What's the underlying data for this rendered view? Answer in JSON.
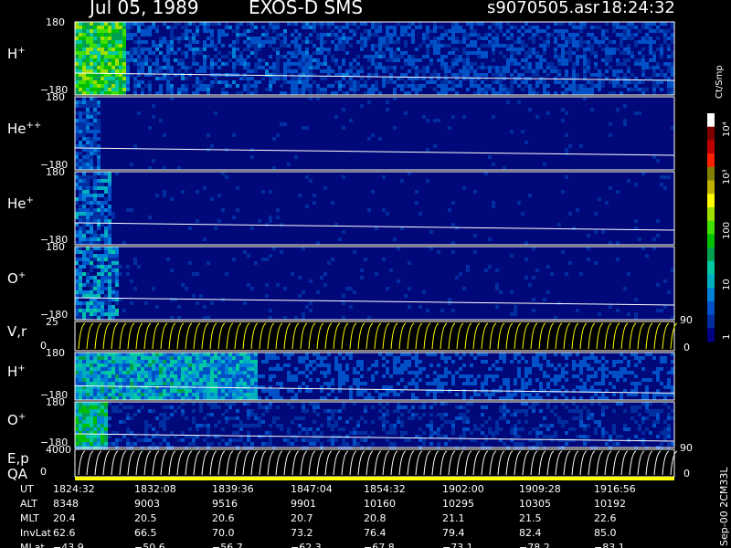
{
  "header": {
    "date": "Jul 05, 1989",
    "instrument": "EXOS-D SMS",
    "file": "s9070505.asr",
    "time": "18:24:32"
  },
  "colorbar": {
    "unit": "Ct/Smp",
    "ticks": [
      "1",
      "10",
      "100",
      "10³",
      "10⁴"
    ],
    "colors": [
      "#000080",
      "#002ea0",
      "#0050c8",
      "#0080d8",
      "#00b0c0",
      "#00c8a0",
      "#00a050",
      "#00c000",
      "#40e000",
      "#a0e000",
      "#ffff00",
      "#c0b000",
      "#808000",
      "#ff2000",
      "#c00000",
      "#800000",
      "#ffffff"
    ]
  },
  "chart_data": {
    "type": "heatmap",
    "panels": [
      {
        "name": "H",
        "sup": "+",
        "yticks": [
          "180",
          "−180"
        ],
        "ylim": [
          -180,
          180
        ]
      },
      {
        "name": "He",
        "sup": "++",
        "yticks": [
          "180",
          "−180"
        ],
        "ylim": [
          -180,
          180
        ]
      },
      {
        "name": "He",
        "sup": "+",
        "yticks": [
          "180",
          "−180"
        ],
        "ylim": [
          -180,
          180
        ]
      },
      {
        "name": "O",
        "sup": "+",
        "yticks": [
          "180",
          "−180"
        ],
        "ylim": [
          -180,
          180
        ]
      },
      {
        "name": "V,r",
        "sup": "",
        "yticks": [
          "25",
          "0"
        ],
        "right_ticks": [
          "90",
          "0"
        ],
        "ylim": [
          0,
          25
        ]
      },
      {
        "name": "H",
        "sup": "+",
        "yticks": [
          "180",
          "−180"
        ],
        "ylim": [
          -180,
          180
        ]
      },
      {
        "name": "O",
        "sup": "+",
        "yticks": [
          "180",
          "−180"
        ],
        "ylim": [
          -180,
          180
        ]
      },
      {
        "name": "E,p",
        "sup": "",
        "yticks": [
          "4000",
          "0"
        ],
        "right_ticks": [
          "90",
          "0"
        ],
        "ylim": [
          0,
          4000
        ]
      },
      {
        "name": "QA",
        "sup": "",
        "yticks": [],
        "ylim": null
      }
    ],
    "x_times": [
      "1824:32",
      "1832:08",
      "1839:36",
      "1847:04",
      "1854:32",
      "1902:00",
      "1909:28",
      "1916:56"
    ],
    "colorbar_ticks": [
      1,
      10,
      100,
      1000,
      10000
    ],
    "colorbar_unit": "Ct/Smp"
  },
  "ephemeris": {
    "rows": [
      {
        "label": "UT",
        "values": [
          "1824:32",
          "1832:08",
          "1839:36",
          "1847:04",
          "1854:32",
          "1902:00",
          "1909:28",
          "1916:56"
        ]
      },
      {
        "label": "ALT",
        "values": [
          "8348",
          "9003",
          "9516",
          "9901",
          "10160",
          "10295",
          "10305",
          "10192"
        ]
      },
      {
        "label": "MLT",
        "values": [
          "20.4",
          "20.5",
          "20.6",
          "20.7",
          "20.8",
          "21.1",
          "21.5",
          "22.6"
        ]
      },
      {
        "label": "InvLat",
        "values": [
          "62.6",
          "66.5",
          "70.0",
          "73.2",
          "76.4",
          "79.4",
          "82.4",
          "85.0"
        ]
      },
      {
        "label": "MLat",
        "values": [
          "−43.9",
          "−50.6",
          "−56.7",
          "−62.3",
          "−67.8",
          "−73.1",
          "−78.2",
          "−83.1"
        ]
      }
    ]
  },
  "footer": {
    "label": "Sep-00 2CM33L"
  }
}
